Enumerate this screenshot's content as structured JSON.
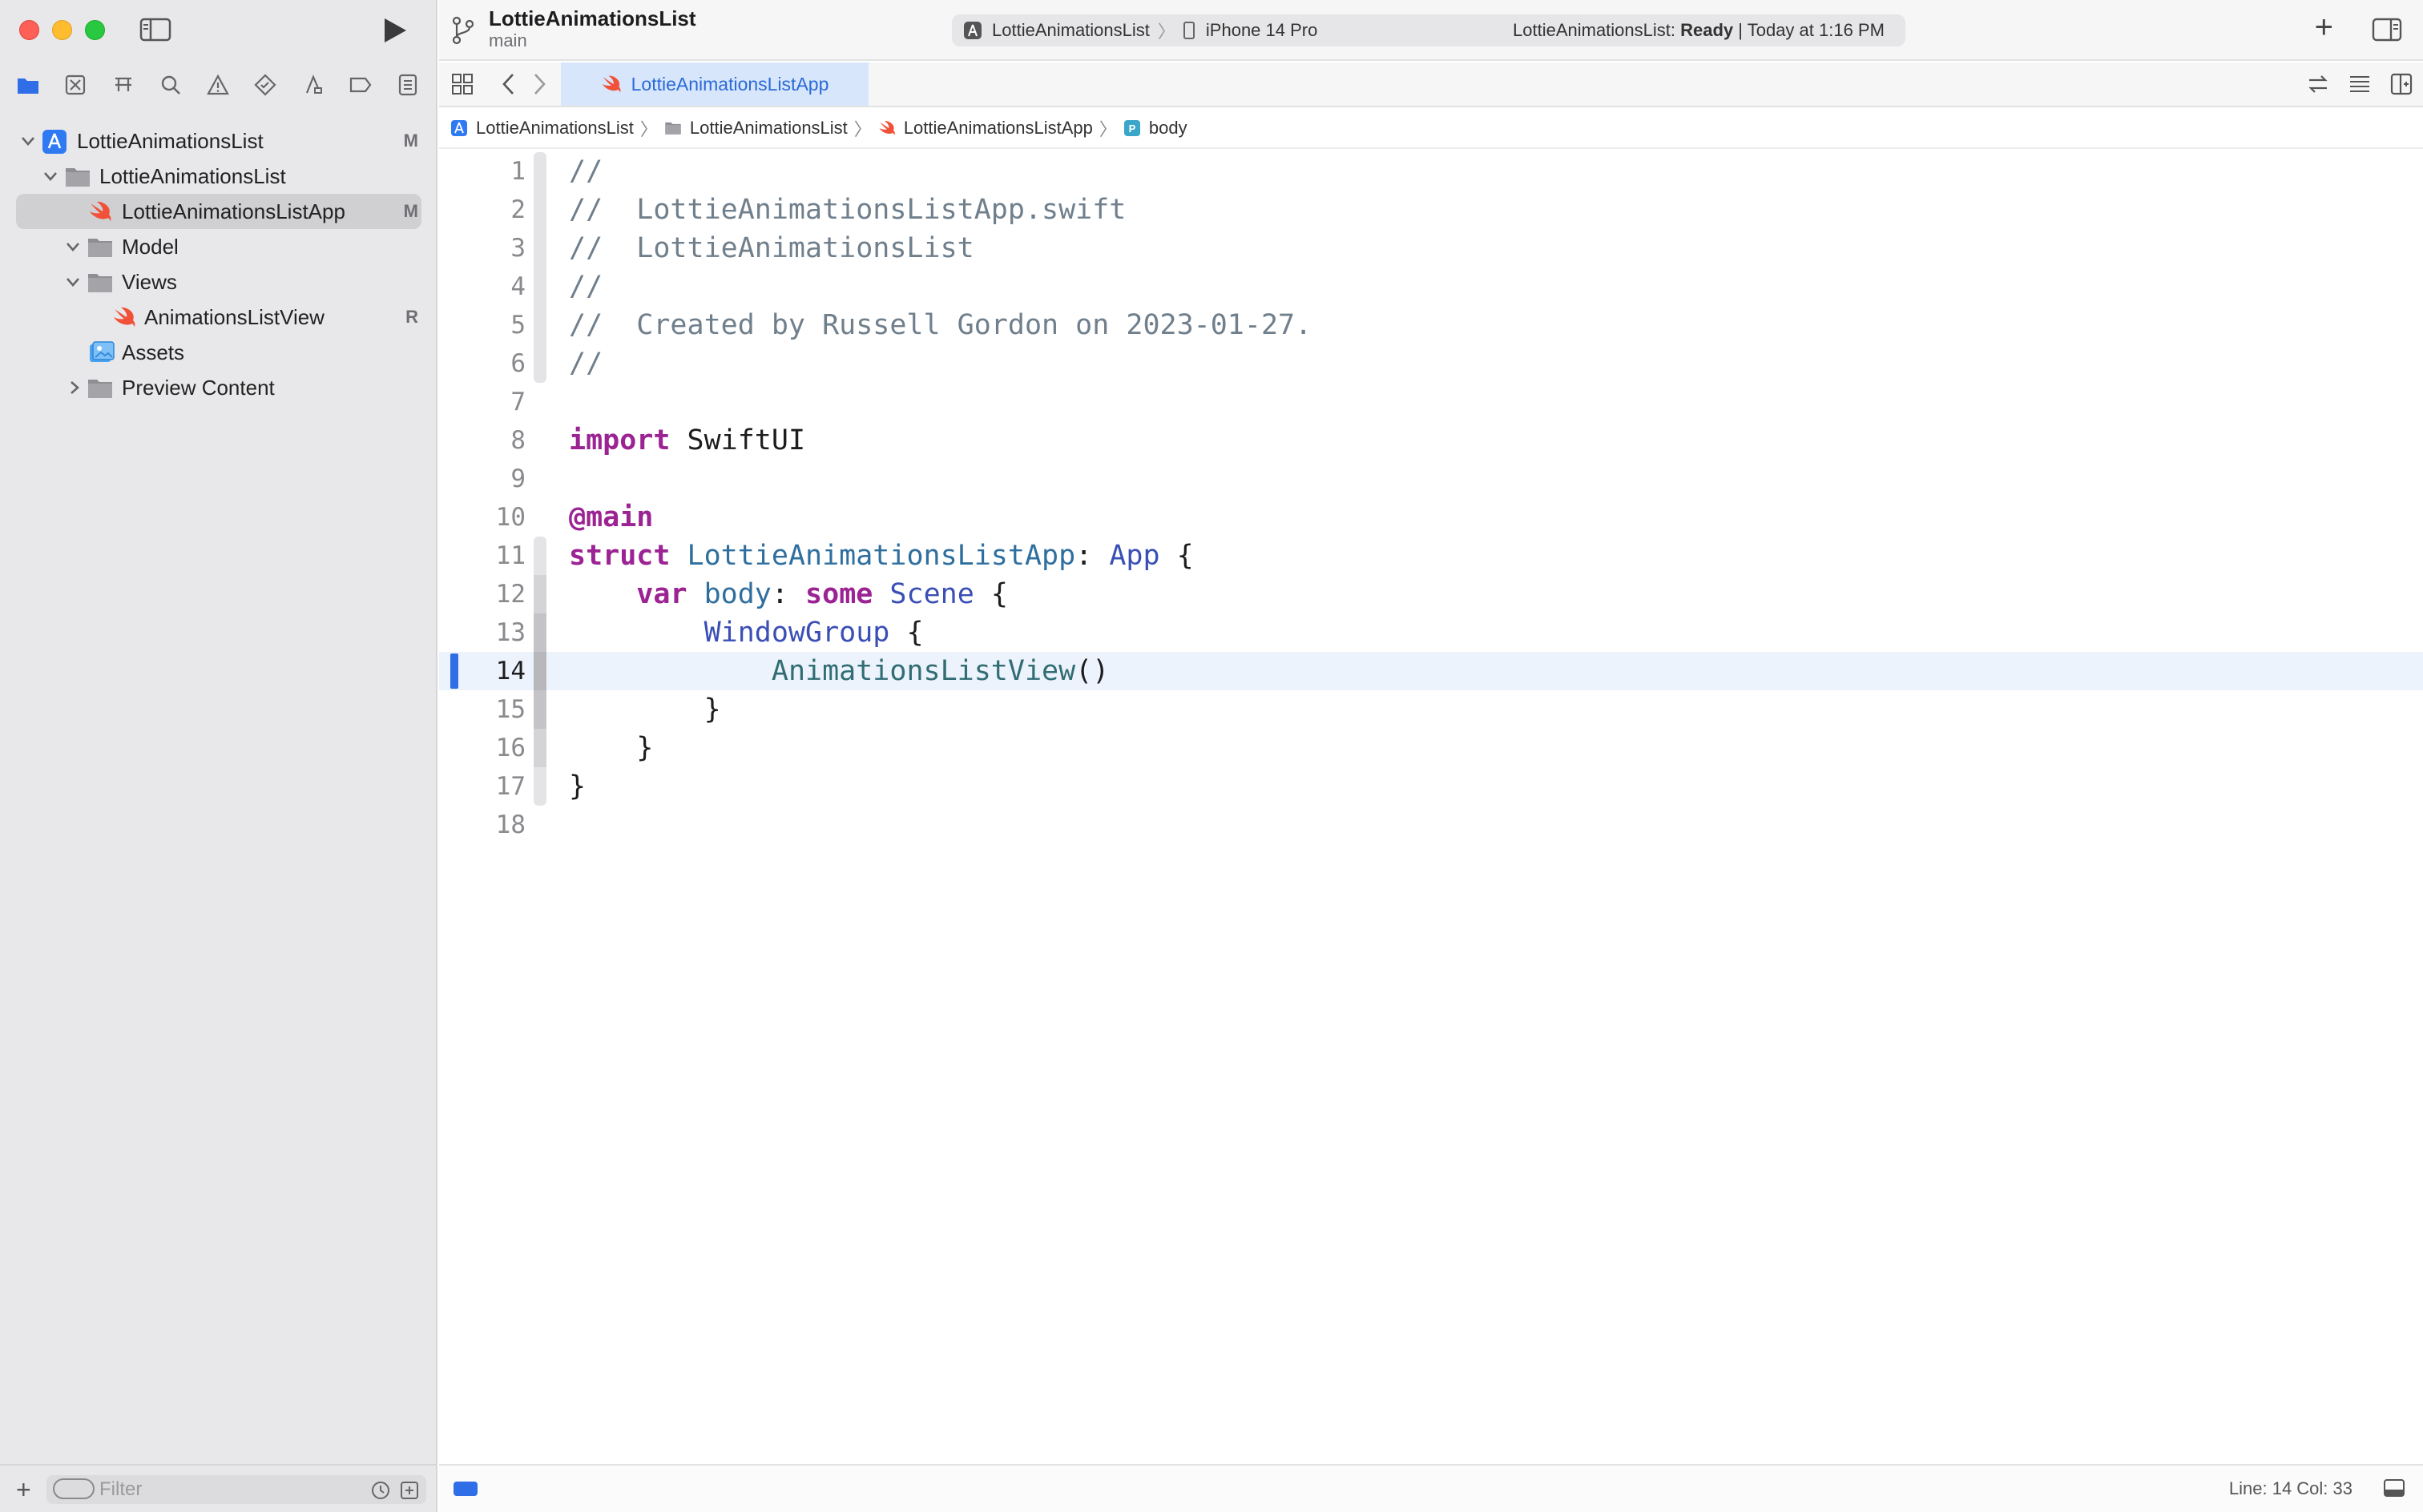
{
  "window": {
    "project_title": "LottieAnimationsList",
    "branch": "main"
  },
  "activity": {
    "scheme": "LottieAnimationsList",
    "device": "iPhone 14 Pro",
    "status_project": "LottieAnimationsList:",
    "status_state": "Ready",
    "status_time": "| Today at 1:16 PM"
  },
  "navigator": {
    "tabs": [
      "folder-icon",
      "source-control-icon",
      "symbol-icon",
      "find-icon",
      "issue-icon",
      "test-icon",
      "debug-icon",
      "breakpoint-icon",
      "report-icon"
    ],
    "tree": [
      {
        "label": "LottieAnimationsList",
        "badge": "M",
        "kind": "project",
        "expanded": true
      },
      {
        "label": "LottieAnimationsList",
        "badge": "",
        "kind": "folder",
        "expanded": true
      },
      {
        "label": "LottieAnimationsListApp",
        "badge": "M",
        "kind": "swift",
        "selected": true
      },
      {
        "label": "Model",
        "badge": "",
        "kind": "folder",
        "expanded": true
      },
      {
        "label": "Views",
        "badge": "",
        "kind": "folder",
        "expanded": true
      },
      {
        "label": "AnimationsListView",
        "badge": "R",
        "kind": "swift"
      },
      {
        "label": "Assets",
        "badge": "",
        "kind": "assets"
      },
      {
        "label": "Preview Content",
        "badge": "",
        "kind": "folder",
        "expanded": false
      }
    ],
    "filter_placeholder": "Filter"
  },
  "editor": {
    "tab_label": "LottieAnimationsListApp",
    "jumpbar": [
      "LottieAnimationsList",
      "LottieAnimationsList",
      "LottieAnimationsListApp",
      "body"
    ],
    "current_line": 14,
    "lines": [
      "//",
      "//  LottieAnimationsListApp.swift",
      "//  LottieAnimationsList",
      "//",
      "//  Created by Russell Gordon on 2023-01-27.",
      "//",
      "",
      "import SwiftUI",
      "",
      "@main",
      "struct LottieAnimationsListApp: App {",
      "    var body: some Scene {",
      "        WindowGroup {",
      "            AnimationsListView()",
      "        }",
      "    }",
      "}",
      ""
    ]
  },
  "statusbar": {
    "cursor": "Line: 14  Col: 33"
  },
  "colors": {
    "accent": "#2f6ee6",
    "keyword": "#9b2393",
    "comment": "#707f8c",
    "swift_orange": "#f05138"
  }
}
